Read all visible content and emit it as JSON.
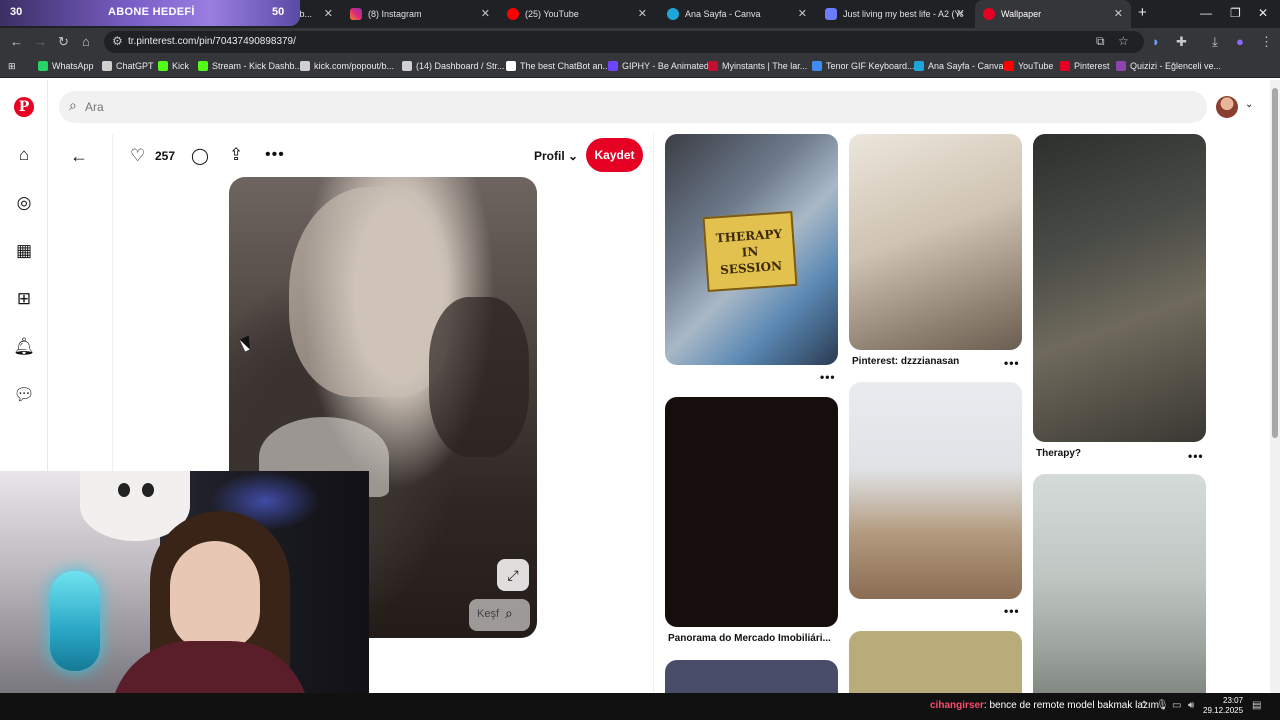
{
  "browser": {
    "overlay": {
      "left_number": "30",
      "goal_text": "ABONE HEDEFİ",
      "right_number": "50"
    },
    "tabs": [
      {
        "title": "Stream - Kick Dashb...",
        "icon": "kick-icon"
      },
      {
        "title": "(8) Instagram",
        "icon": "instagram-icon"
      },
      {
        "title": "(25) YouTube",
        "icon": "youtube-icon"
      },
      {
        "title": "Ana Sayfa - Canva",
        "icon": "canva-icon"
      },
      {
        "title": "Just living my best life - A2 (Ya...",
        "icon": "app-icon"
      },
      {
        "title": "Wallpaper",
        "icon": "pinterest-icon"
      }
    ],
    "url": "tr.pinterest.com/pin/70437490898379/",
    "bookmarks": [
      {
        "label": "WhatsApp",
        "color": "#25d366"
      },
      {
        "label": "ChatGPT",
        "color": "#cfcfcf"
      },
      {
        "label": "Kick",
        "color": "#53fc18"
      },
      {
        "label": "Stream - Kick Dashb...",
        "color": "#53fc18"
      },
      {
        "label": "kick.com/popout/b...",
        "color": "#cfcfcf"
      },
      {
        "label": "(14) Dashboard / Str...",
        "color": "#cfcfcf"
      },
      {
        "label": "The best ChatBot an...",
        "color": "#ffffff"
      },
      {
        "label": "GIPHY - Be Animated",
        "color": "#6e45ff"
      },
      {
        "label": "Myinstants | The lar...",
        "color": "#c0102f"
      },
      {
        "label": "Tenor GIF Keyboard...",
        "color": "#3d8df5"
      },
      {
        "label": "Ana Sayfa - Canva",
        "color": "#1fa6d8"
      },
      {
        "label": "YouTube",
        "color": "#ff0000"
      },
      {
        "label": "Pinterest",
        "color": "#e60023"
      },
      {
        "label": "Quizizi - Eğlenceli vе...",
        "color": "#8e44ad"
      }
    ]
  },
  "pinterest": {
    "search_placeholder": "Ara",
    "like_count": "257",
    "profile_label": "Profil",
    "save_label": "Kaydet",
    "explore_label": "Keşf",
    "accent": "#e60023",
    "grid": {
      "caption_pinterest": "Pinterest: dzzzianasan",
      "caption_therapy": "Therapy?",
      "caption_panorama": "Panorama do Mercado Imobiliári...",
      "sign_lines": [
        "THERAPY",
        "IN",
        "SESSION"
      ]
    }
  },
  "stream": {
    "chat_user": "cihangirser",
    "chat_message": ": bence de remote model bakmak lazım"
  },
  "taskbar": {
    "time": "23:07",
    "date": "29.12.2025"
  }
}
